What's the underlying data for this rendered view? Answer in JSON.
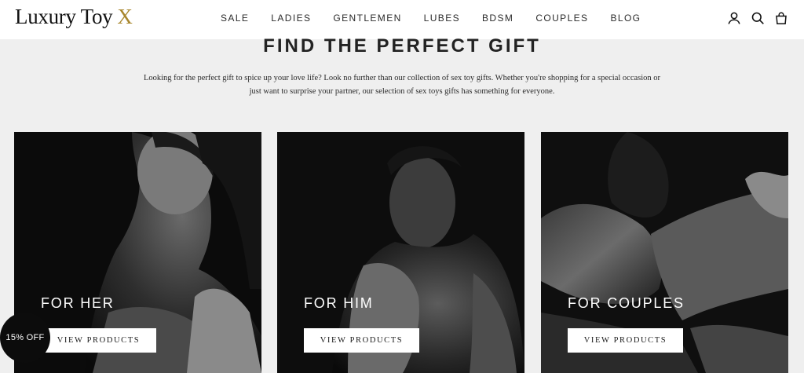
{
  "header": {
    "logo_text": "Luxury Toy",
    "logo_mark": "X",
    "logo_mark_color": "#a8862c",
    "nav": [
      "SALE",
      "LADIES",
      "GENTLEMEN",
      "LUBES",
      "BDSM",
      "COUPLES",
      "BLOG"
    ],
    "icons": [
      "account-icon",
      "search-icon",
      "cart-icon"
    ]
  },
  "main": {
    "title": "FIND THE PERFECT GIFT",
    "intro": "Looking for the perfect gift to spice up your love life? Look no further than our collection of sex toy gifts. Whether you're shopping for a special occasion or just want to surprise your partner, our selection of sex toys gifts has something for everyone.",
    "cards": [
      {
        "title": "FOR HER",
        "button": "VIEW PRODUCTS"
      },
      {
        "title": "FOR HIM",
        "button": "VIEW PRODUCTS"
      },
      {
        "title": "FOR COUPLES",
        "button": "VIEW PRODUCTS"
      }
    ]
  },
  "discount_badge": "15% OFF"
}
